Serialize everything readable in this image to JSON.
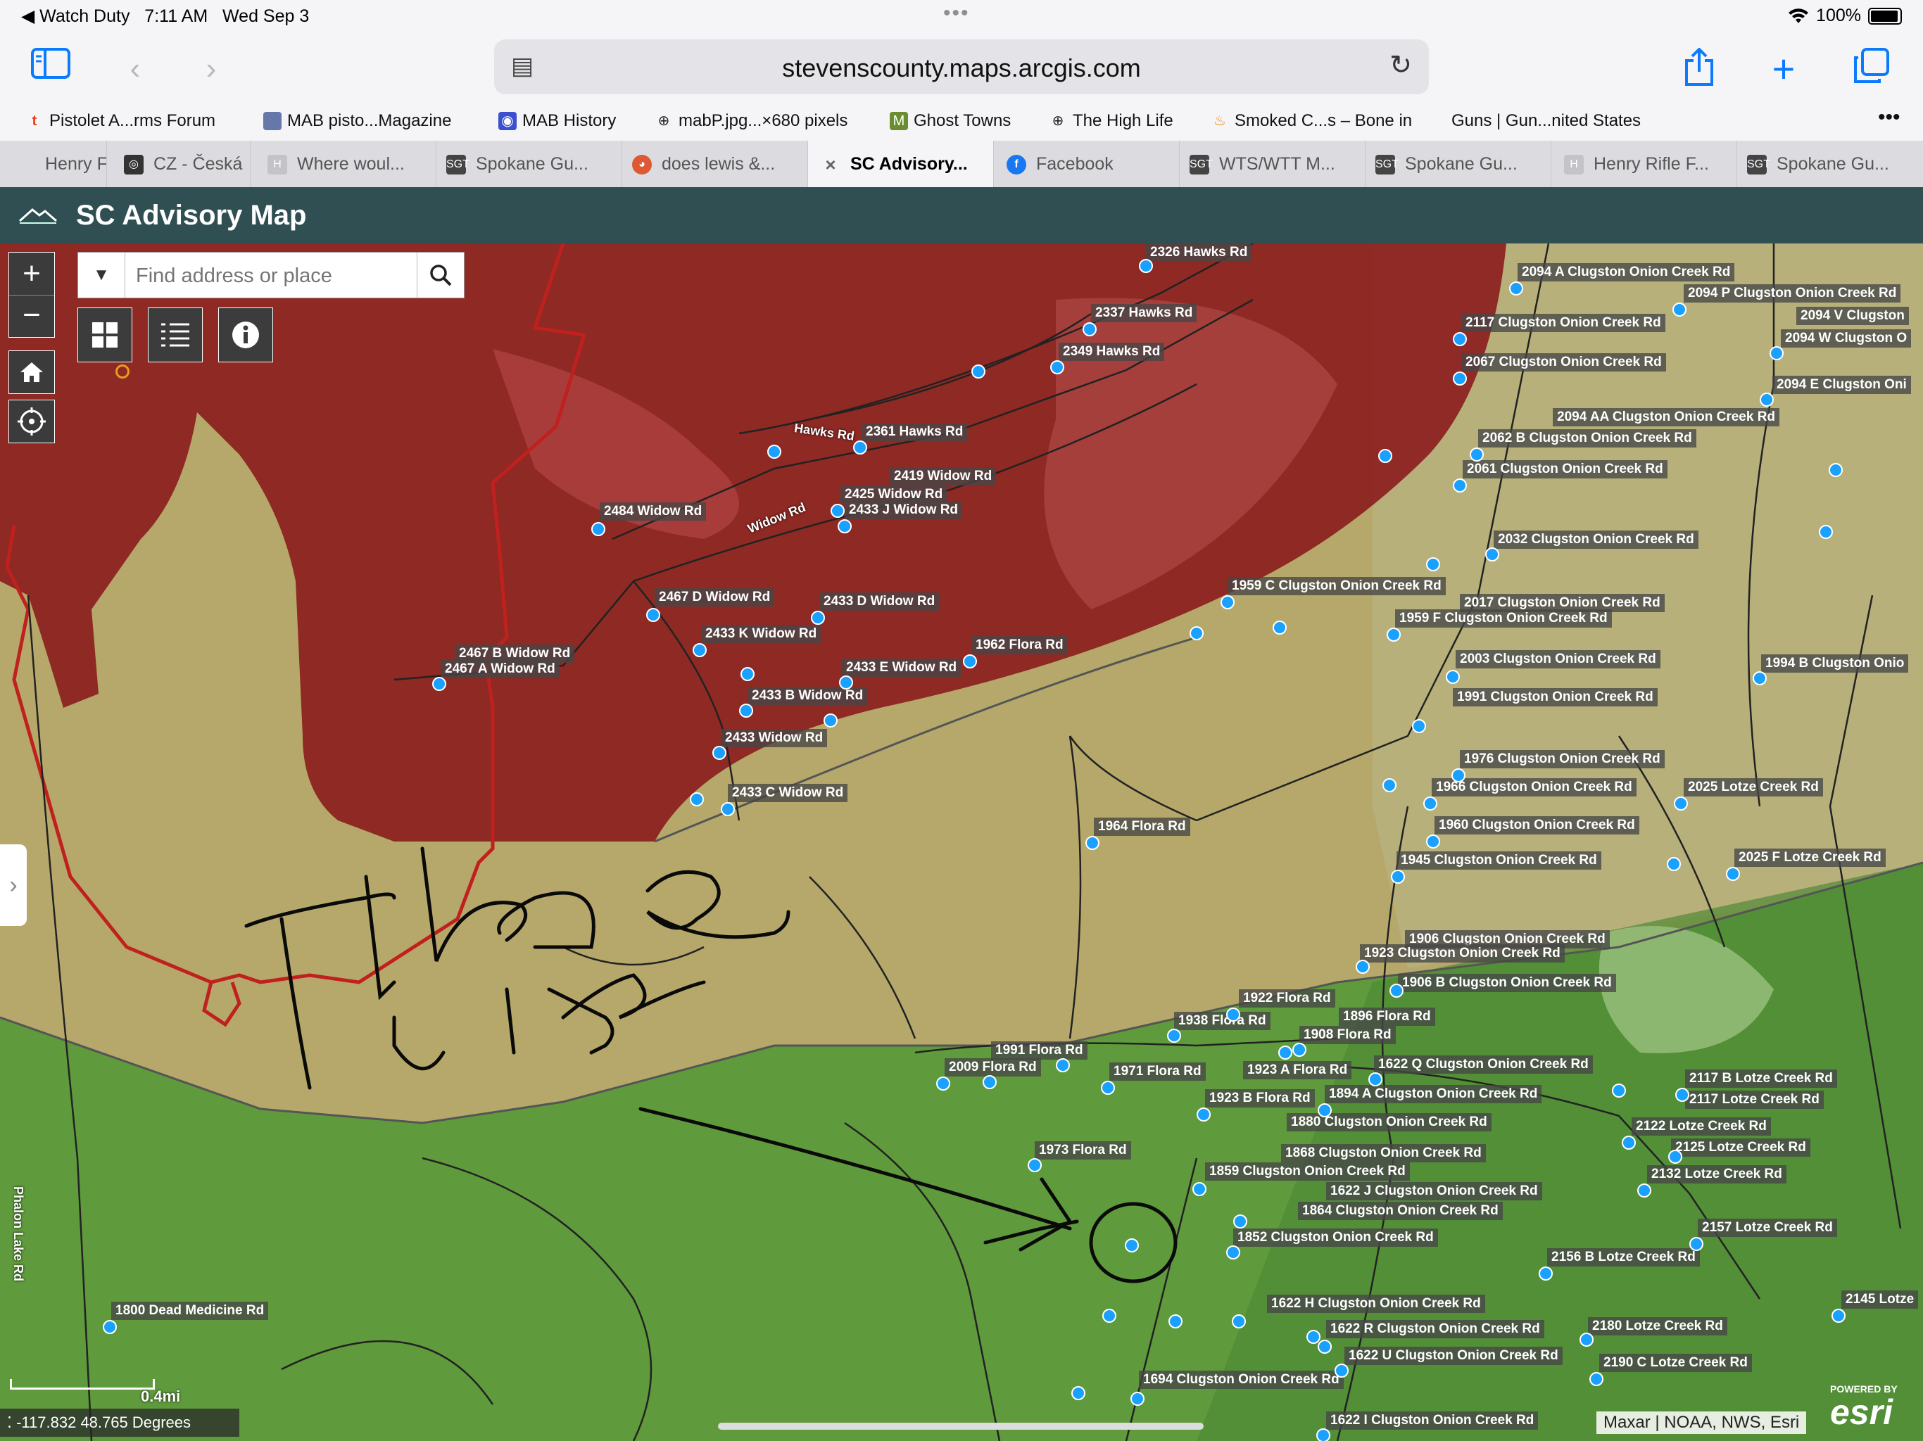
{
  "status": {
    "back_app": "◀ Watch Duty",
    "time": "7:11 AM",
    "date": "Wed Sep 3",
    "battery": "100%"
  },
  "browser": {
    "url": "stevenscounty.maps.arcgis.com",
    "favorites": [
      {
        "label": "Pistolet A...rms Forum",
        "icon": "t"
      },
      {
        "label": "MAB pisto...Magazine",
        "icon": "m"
      },
      {
        "label": "MAB History",
        "icon": "eye"
      },
      {
        "label": "mabP.jpg...×680 pixels",
        "icon": "globe"
      },
      {
        "label": "Ghost Towns",
        "icon": "M"
      },
      {
        "label": "The High Life",
        "icon": "globe"
      },
      {
        "label": "Smoked C...s – Bone in",
        "icon": "flame"
      },
      {
        "label": "Guns | Gun...nited States",
        "icon": ""
      }
    ],
    "tabs": [
      {
        "label": "Henry F",
        "icon": ""
      },
      {
        "label": "CZ - Česká",
        "icon": "cz"
      },
      {
        "label": "Where woul...",
        "icon": "H"
      },
      {
        "label": "Spokane Gu...",
        "icon": "SGT"
      },
      {
        "label": "does lewis &...",
        "icon": "ddg"
      },
      {
        "label": "SC Advisory...",
        "icon": "x"
      },
      {
        "label": "Facebook",
        "icon": "f"
      },
      {
        "label": "WTS/WTT M...",
        "icon": "SGT"
      },
      {
        "label": "Spokane Gu...",
        "icon": "SGT"
      },
      {
        "label": "Henry Rifle F...",
        "icon": "H"
      },
      {
        "label": "Spokane Gu...",
        "icon": "SGT"
      }
    ]
  },
  "app": {
    "title": "SC Advisory Map",
    "search_placeholder": "Find address or place",
    "coords": "-117.832 48.765 Degrees",
    "scale": "0.4mi",
    "attribution": "Maxar | NOAA, NWS, Esri",
    "esri_powered": "POWERED BY",
    "esri_logo": "esri"
  },
  "map": {
    "road_labels": [
      {
        "text": "Hawks Rd"
      },
      {
        "text": "Widow Rd"
      },
      {
        "text": "Phalon Lake Rd"
      }
    ],
    "handwriting": "Fire Line",
    "addresses": [
      "2326 Hawks Rd",
      "2337 Hawks Rd",
      "2349 Hawks Rd",
      "2361 Hawks Rd",
      "2419 Widow Rd",
      "2425 Widow Rd",
      "2433 J Widow Rd",
      "2484 Widow Rd",
      "2467 D Widow Rd",
      "2433 D Widow Rd",
      "2433 K Widow Rd",
      "1962 Flora Rd",
      "2467 B Widow Rd",
      "2467 A Widow Rd",
      "2433 E Widow Rd",
      "2433 B Widow Rd",
      "2433 Widow Rd",
      "2433 C Widow Rd",
      "1964 Flora Rd",
      "2094 A Clugston Onion Creek Rd",
      "2094 P Clugston Onion Creek Rd",
      "2094 V Clugston",
      "2117 Clugston Onion Creek Rd",
      "2094 W Clugston O",
      "2067 Clugston Onion Creek Rd",
      "2094 E Clugston Oni",
      "2094 AA Clugston Onion Creek Rd",
      "2062 B Clugston Onion Creek Rd",
      "2061 Clugston Onion Creek Rd",
      "2032 Clugston Onion Creek Rd",
      "1959 C Clugston Onion Creek Rd",
      "2017 Clugston Onion Creek Rd",
      "1959 F Clugston Onion Creek Rd",
      "2003 Clugston Onion Creek Rd",
      "1994 B Clugston Onio",
      "1991 Clugston Onion Creek Rd",
      "1976 Clugston Onion Creek Rd",
      "1966 Clugston Onion Creek Rd",
      "2025 Lotze Creek Rd",
      "1960 Clugston Onion Creek Rd",
      "1945 Clugston Onion Creek Rd",
      "2025 F Lotze Creek Rd",
      "1906 Clugston Onion Creek Rd",
      "1923 Clugston Onion Creek Rd",
      "1906 B Clugston Onion Creek Rd",
      "1922 Flora Rd",
      "1938 Flora Rd",
      "1896 Flora Rd",
      "1908 Flora Rd",
      "1991 Flora Rd",
      "2009 Flora Rd",
      "1971 Flora Rd",
      "1923 A Flora Rd",
      "1622 Q Clugston Onion Creek Rd",
      "2117 B Lotze Creek Rd",
      "1894 A Clugston Onion Creek Rd",
      "1923 B Flora Rd",
      "2117 Lotze Creek Rd",
      "1880 Clugston Onion Creek Rd",
      "2122 Lotze Creek Rd",
      "1973 Flora Rd",
      "1868 Clugston Onion Creek Rd",
      "2125 Lotze Creek Rd",
      "1859 Clugston Onion Creek Rd",
      "2132 Lotze Creek Rd",
      "1622 J Clugston Onion Creek Rd",
      "1864 Clugston Onion Creek Rd",
      "2157 Lotze Creek Rd",
      "1852 Clugston Onion Creek Rd",
      "2156 B Lotze Creek Rd",
      "1800 Dead Medicine Rd",
      "1622 H Clugston Onion Creek Rd",
      "2145 Lotze",
      "1622 R Clugston Onion Creek Rd",
      "2180 Lotze Creek Rd",
      "1622 U Clugston Onion Creek Rd",
      "2190 C Lotze Creek Rd",
      "1694 Clugston Onion Creek Rd",
      "1622 I Clugston Onion Creek Rd"
    ]
  }
}
